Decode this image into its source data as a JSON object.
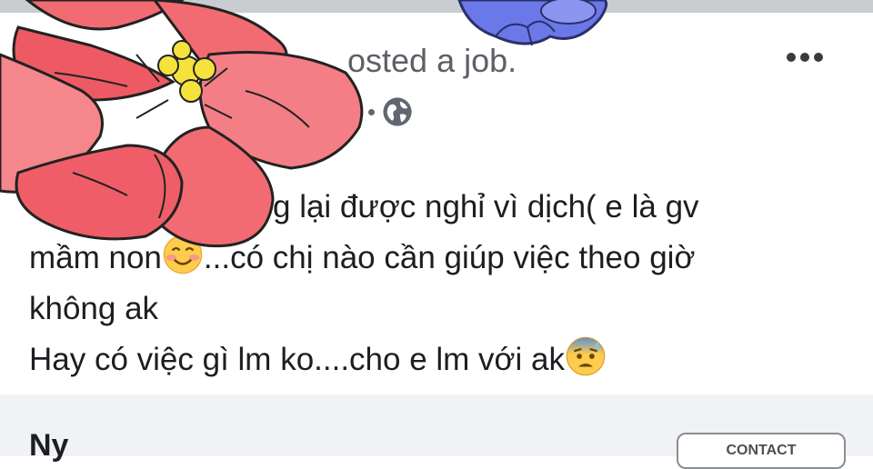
{
  "post": {
    "header_fragment": "osted a job.",
    "body_lines": [
      "g lại được nghỉ vì dịch( e là gv",
      "mầm non",
      "...có chị nào cần giúp việc theo giờ",
      "không ak",
      "Hay có việc gì lm ko....cho e lm với ak"
    ],
    "emojis": [
      "smiling-face-with-smiling-eyes",
      "anxious-face-with-sweat"
    ]
  },
  "footer": {
    "name_fragment": "Ny",
    "contact_label": "CONTACT"
  },
  "icons": {
    "more": "more-options-icon",
    "privacy": "globe-icon"
  },
  "colors": {
    "footer_bg": "#f0f2f5",
    "top_bar": "#c9ccd1",
    "flower_red": "#f26b72",
    "flower_blue": "#6b78e8"
  }
}
